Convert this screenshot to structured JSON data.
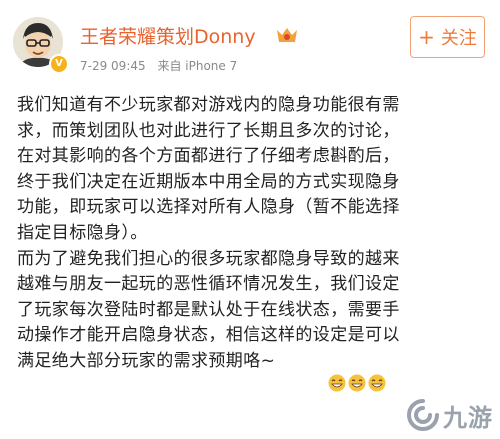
{
  "post": {
    "author": "王者荣耀策划Donny",
    "timestamp": "7-29 09:45",
    "source": "来自 iPhone 7",
    "follow_label": "关注",
    "follow_icon": "plus-icon",
    "text": "我们知道有不少玩家都对游戏内的隐身功能很有需\n求，而策划团队也对此进行了长期且多次的讨论，\n在对其影响的各个方面都进行了仔细考虑斟酌后，\n终于我们决定在近期版本中用全局的方式实现隐身\n功能，即玩家可以选择对所有人隐身（暂不能选择\n指定目标隐身）。\n而为了避免我们担心的很多玩家都隐身导致的越来\n越难与朋友一起玩的恶性循环情况发生，我们设定\n了玩家每次登陆时都是默认处于在线状态，需要手\n动操作才能开启隐身状态，相信这样的设定是可以\n满足绝大部分玩家的需求预期咯~",
    "emojis": [
      "grin-emoji",
      "grin-emoji",
      "grin-emoji"
    ]
  },
  "watermark": {
    "text": "九游"
  },
  "colors": {
    "author": "#e8632f",
    "follow": "#f07a3b",
    "meta": "#8a8a8a",
    "text": "#222222"
  }
}
